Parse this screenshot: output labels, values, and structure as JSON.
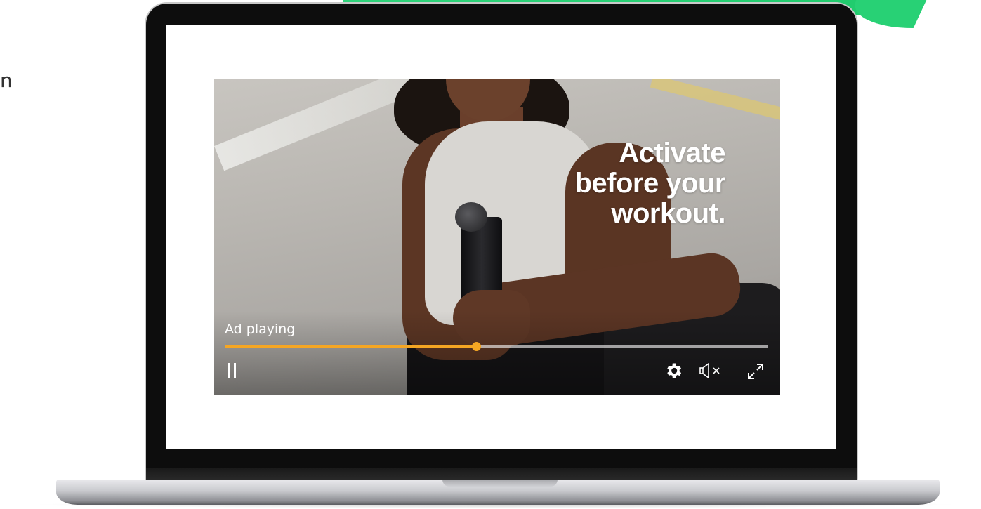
{
  "side_text": "n",
  "video_ad": {
    "headline_lines": [
      "Activate",
      "before your",
      "workout."
    ],
    "status_label": "Ad playing",
    "progress": 0.463,
    "progress_color": "#f5a623"
  },
  "controls": {
    "pause_icon": "pause-icon",
    "settings_icon": "gear-icon",
    "mute_icon": "speaker-muted-icon",
    "fullscreen_icon": "fullscreen-icon"
  },
  "colors": {
    "accent_banner": "#2fd37a",
    "laptop_bezel": "#0d0d0d"
  }
}
